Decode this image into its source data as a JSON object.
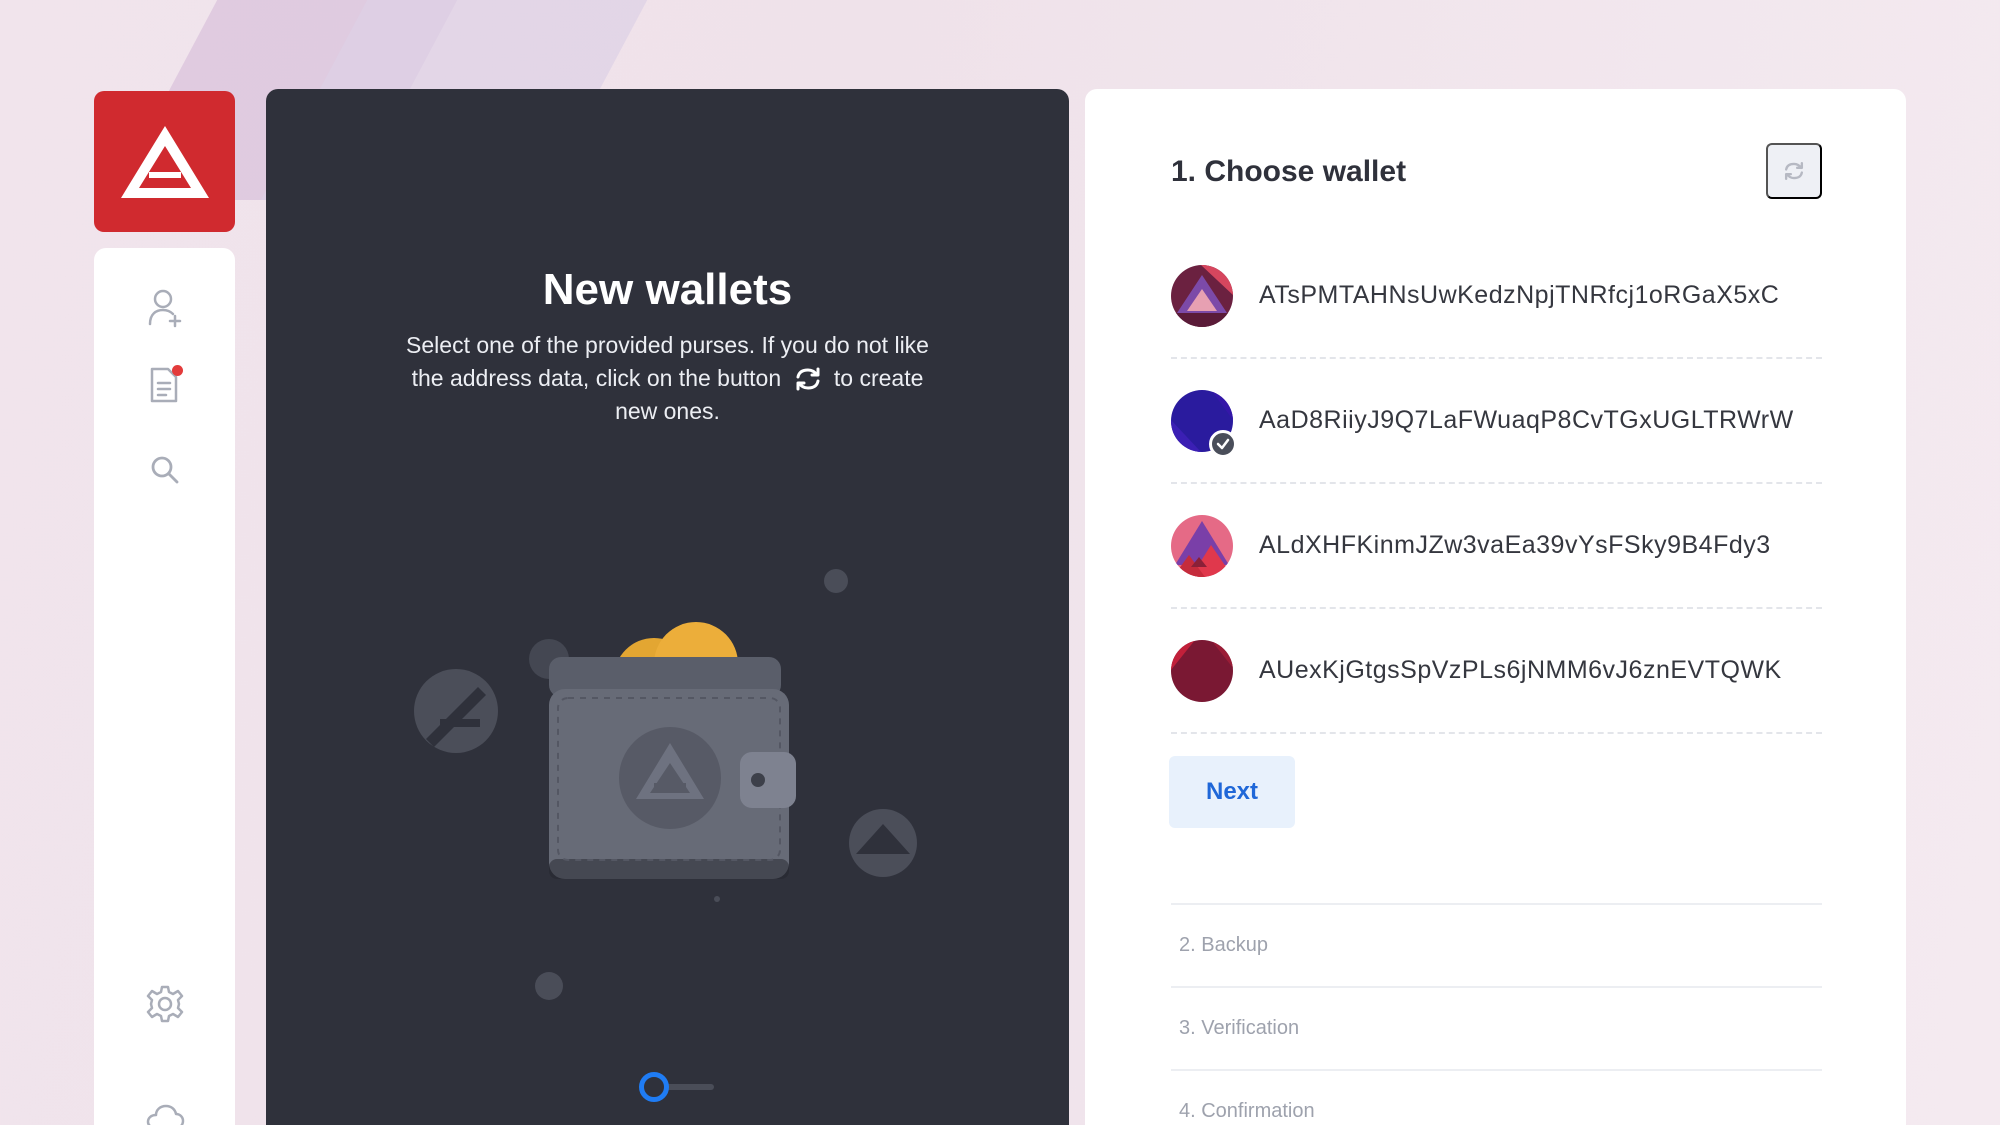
{
  "app": {
    "logo_name": "ARK logo"
  },
  "sidebar": {
    "items": [
      {
        "name": "add-contact",
        "icon": "user-plus-icon"
      },
      {
        "name": "transactions",
        "icon": "document-icon",
        "notification": true
      },
      {
        "name": "search",
        "icon": "search-icon"
      },
      {
        "name": "settings",
        "icon": "gear-icon"
      },
      {
        "name": "network",
        "icon": "cloud-icon"
      }
    ]
  },
  "intro": {
    "title": "New wallets",
    "description_before": "Select one of the provided purses. If you do not like the address data, click on the button",
    "description_after": "to create new ones.",
    "progress": 0.35
  },
  "wizard": {
    "current_step_title": "1. Choose wallet",
    "wallets": [
      {
        "address": "ATsPMTAHNsUwKedzNpjTNRfcj1oRGaX5xC",
        "selected": false
      },
      {
        "address": "AaD8RiiyJ9Q7LaFWuaqP8CvTGxUGLTRWrW",
        "selected": true
      },
      {
        "address": "ALdXHFKinmJZw3vaEa39vYsFSky9B4Fdy3",
        "selected": false
      },
      {
        "address": "AUexKjGtgsSpVzPLs6jNMM6vJ6znEVTQWK",
        "selected": false
      }
    ],
    "next_label": "Next",
    "steps": [
      {
        "label": "2. Backup"
      },
      {
        "label": "3. Verification"
      },
      {
        "label": "4. Confirmation"
      }
    ]
  },
  "colors": {
    "brand": "#d02a2f",
    "accent": "#1f7cf4",
    "panel_dark": "#2f313b"
  }
}
